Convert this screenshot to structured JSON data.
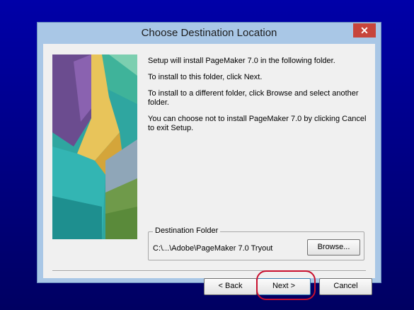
{
  "window": {
    "title": "Choose Destination Location",
    "close_label": "✕"
  },
  "body": {
    "line1": "Setup will install PageMaker 7.0 in the following folder.",
    "line2": "To install to this folder, click Next.",
    "line3": "To install to a different folder, click Browse and select another folder.",
    "line4": "You can choose not to install PageMaker 7.0 by clicking Cancel to exit Setup."
  },
  "destination": {
    "legend": "Destination Folder",
    "path": "C:\\...\\Adobe\\PageMaker 7.0 Tryout",
    "browse_label": "Browse..."
  },
  "buttons": {
    "back_label": "< Back",
    "next_label": "Next >",
    "cancel_label": "Cancel"
  },
  "colors": {
    "desktop": "#00007e",
    "title_bar": "#a9c7e6",
    "close_button": "#c7453b",
    "highlight_ring": "#c8102e"
  }
}
